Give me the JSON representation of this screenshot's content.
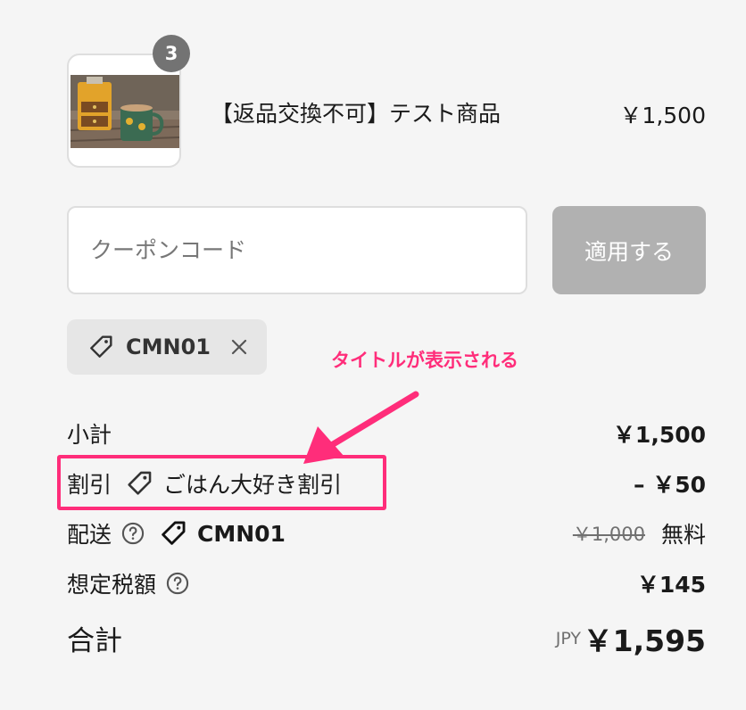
{
  "product": {
    "quantity": "3",
    "title": "【返品交換不可】テスト商品",
    "price": "￥1,500"
  },
  "coupon": {
    "placeholder": "クーポンコード",
    "apply_label": "適用する",
    "applied_code": "CMN01"
  },
  "annotation": {
    "text": "タイトルが表示される",
    "color": "#ff2d7a"
  },
  "summary": {
    "subtotal_label": "小計",
    "subtotal_value": "￥1,500",
    "discount_label": "割引",
    "discount_title": "ごはん大好き割引",
    "discount_value": "– ￥50",
    "shipping_label": "配送",
    "shipping_code": "CMN01",
    "shipping_original": "￥1,000",
    "shipping_value": "無料",
    "tax_label": "想定税額",
    "tax_value": "￥145",
    "total_label": "合計",
    "total_currency": "JPY",
    "total_value": "￥1,595"
  }
}
